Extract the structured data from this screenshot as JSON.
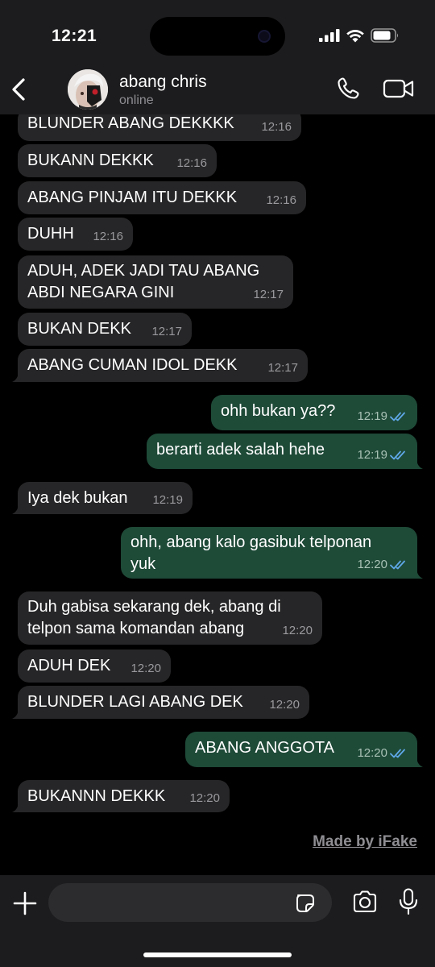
{
  "status_bar": {
    "time": "12:21"
  },
  "header": {
    "contact_name": "abang chris",
    "contact_status": "online"
  },
  "messages": [
    {
      "dir": "in",
      "lines": [
        "BLUNDER ABANG DEKKKK"
      ],
      "time": "12:16"
    },
    {
      "dir": "in",
      "lines": [
        "BUKANN DEKKK"
      ],
      "time": "12:16"
    },
    {
      "dir": "in",
      "lines": [
        "ABANG PINJAM ITU DEKKK"
      ],
      "time": "12:16"
    },
    {
      "dir": "in",
      "lines": [
        "DUHH"
      ],
      "time": "12:16"
    },
    {
      "dir": "in",
      "lines": [
        "ADUH, ADEK JADI TAU ABANG",
        "ABDI NEGARA GINI"
      ],
      "time": "12:17"
    },
    {
      "dir": "in",
      "lines": [
        "BUKAN DEKK"
      ],
      "time": "12:17"
    },
    {
      "dir": "in",
      "lines": [
        "ABANG CUMAN IDOL DEKK"
      ],
      "time": "12:17"
    },
    {
      "dir": "out",
      "lines": [
        "ohh bukan ya??"
      ],
      "time": "12:19"
    },
    {
      "dir": "out",
      "lines": [
        "berarti adek salah hehe"
      ],
      "time": "12:19"
    },
    {
      "dir": "in",
      "lines": [
        "Iya dek bukan"
      ],
      "time": "12:19"
    },
    {
      "dir": "out",
      "lines": [
        "ohh, abang kalo gasibuk telponan",
        "yuk"
      ],
      "time": "12:20"
    },
    {
      "dir": "in",
      "lines": [
        "Duh gabisa sekarang dek, abang di",
        "telpon sama komandan abang"
      ],
      "time": "12:20"
    },
    {
      "dir": "in",
      "lines": [
        "ADUH DEK"
      ],
      "time": "12:20"
    },
    {
      "dir": "in",
      "lines": [
        "BLUNDER LAGI ABANG DEK"
      ],
      "time": "12:20"
    },
    {
      "dir": "out",
      "lines": [
        "ABANG ANGGOTA"
      ],
      "time": "12:20"
    },
    {
      "dir": "in",
      "lines": [
        "BUKANNN DEKKK"
      ],
      "time": "12:20"
    }
  ],
  "watermark": "Made by iFake",
  "input": {
    "placeholder": ""
  },
  "colors": {
    "incoming_bubble": "#262628",
    "outgoing_bubble": "#1e4a38",
    "read_ticks": "#5fa8e8",
    "background": "#000000"
  },
  "icons": [
    "back-chevron",
    "phone",
    "video-camera",
    "plus",
    "sticker",
    "camera",
    "microphone",
    "double-check"
  ]
}
